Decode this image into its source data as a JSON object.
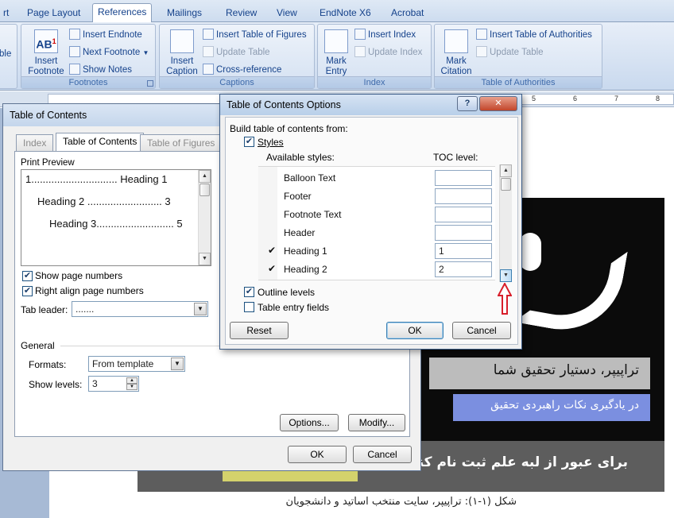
{
  "ribbon": {
    "tabs": [
      "rt",
      "Page Layout",
      "References",
      "Mailings",
      "Review",
      "View",
      "EndNote X6",
      "Acrobat"
    ],
    "active_tab": "References",
    "groups": {
      "toc": {
        "label": "ble"
      },
      "footnotes": {
        "label": "Footnotes",
        "insert_footnote": "Insert\nFootnote",
        "insert_endnote": "Insert Endnote",
        "next_footnote": "Next Footnote",
        "show_notes": "Show Notes"
      },
      "captions": {
        "label": "Captions",
        "insert_caption": "Insert\nCaption",
        "insert_tof": "Insert Table of Figures",
        "update_table": "Update Table",
        "cross_reference": "Cross-reference"
      },
      "index": {
        "label": "Index",
        "mark_entry": "Mark\nEntry",
        "insert_index": "Insert Index",
        "update_index": "Update Index"
      },
      "toa": {
        "label": "Table of Authorities",
        "mark_citation": "Mark\nCitation",
        "insert_toa": "Insert Table of Authorities",
        "update_table": "Update Table"
      }
    }
  },
  "ruler": {
    "marks": [
      "5",
      "6",
      "7",
      "8"
    ]
  },
  "document": {
    "tag1": "تراپیپر، دستیار تحقیق شما",
    "tag2": "در یادگیری نکات راهبردی تحقیق",
    "tag3": "برای عبور از لبه علم ثبت نام کنید!",
    "caption": "شکل (۱-۱): تراپیپر، سایت منتخب اساتید و دانشجویان"
  },
  "toc_dialog": {
    "title": "Table of Contents",
    "tabs": [
      "Index",
      "Table of Contents",
      "Table of Figures"
    ],
    "print_preview_label": "Print Preview",
    "preview_rows": [
      "1.............................. Heading 1",
      "Heading 2 .......................... 3",
      "Heading 3........................... 5"
    ],
    "show_page_numbers": "Show page numbers",
    "right_align": "Right align page numbers",
    "tab_leader_label": "Tab leader:",
    "tab_leader_value": ".......",
    "general_label": "General",
    "formats_label": "Formats:",
    "formats_value": "From template",
    "show_levels_label": "Show levels:",
    "show_levels_value": "3",
    "options_button": "Options...",
    "modify_button": "Modify...",
    "ok_button": "OK",
    "cancel_button": "Cancel"
  },
  "options_dialog": {
    "title": "Table of Contents Options",
    "build_label": "Build table of contents from:",
    "styles_label": "Styles",
    "available_styles_label": "Available styles:",
    "toc_level_label": "TOC level:",
    "styles": [
      {
        "name": "Balloon Text",
        "checked": false,
        "level": ""
      },
      {
        "name": "Footer",
        "checked": false,
        "level": ""
      },
      {
        "name": "Footnote Text",
        "checked": false,
        "level": ""
      },
      {
        "name": "Header",
        "checked": false,
        "level": ""
      },
      {
        "name": "Heading 1",
        "checked": true,
        "level": "1"
      },
      {
        "name": "Heading 2",
        "checked": true,
        "level": "2"
      }
    ],
    "outline_levels": "Outline levels",
    "table_entry_fields": "Table entry fields",
    "reset_button": "Reset",
    "ok_button": "OK",
    "cancel_button": "Cancel",
    "help_button": "?",
    "close_button": "✕"
  }
}
